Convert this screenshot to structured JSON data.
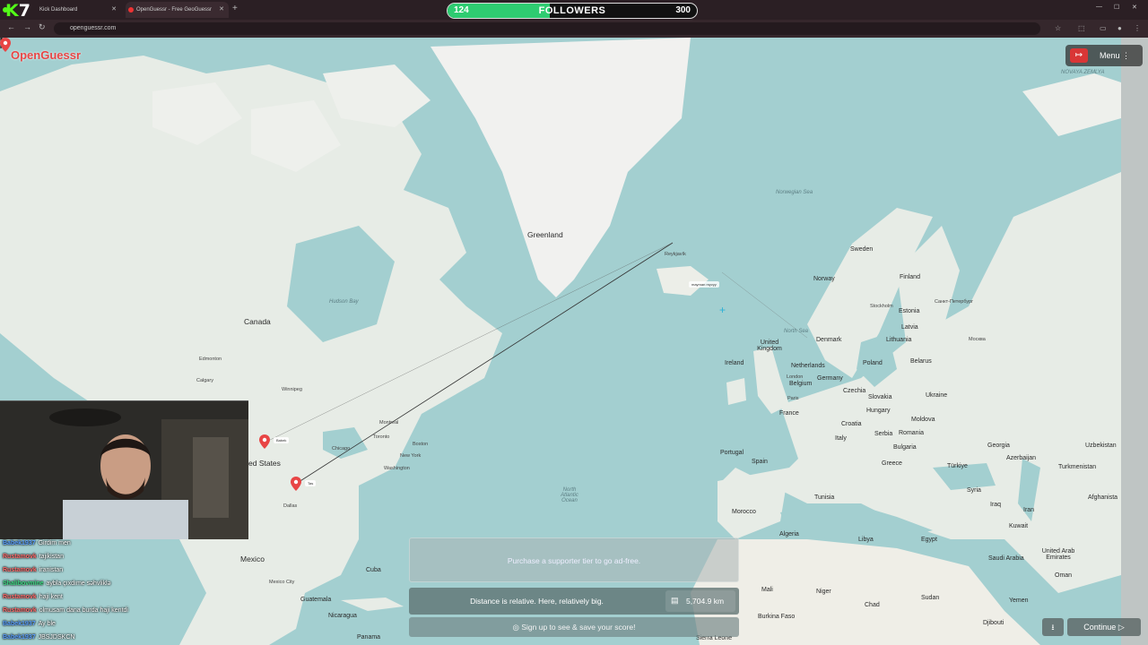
{
  "browser": {
    "tabs": [
      {
        "title": "Kick Dashboard"
      },
      {
        "title": "OpenGuessr - Free GeoGuessr"
      }
    ],
    "url": "openguessr.com"
  },
  "overlay": {
    "kick_badge": "7",
    "followers_current": "124",
    "followers_label": "FOLLOWERS",
    "followers_goal": "300",
    "followers_progress": 0.41
  },
  "game": {
    "brand": "OpenGuessr",
    "menu_label": "Menu",
    "exit_icon": "exit-icon",
    "ad_text": "Purchase a supporter tier to go ad-free.",
    "distance_text": "Distance is relative. Here, relatively big.",
    "distance_value": "5,704.9 km",
    "signup_text": "Sign up to see & save your score!",
    "continue_label": "Continue",
    "guess_tag": "mayman myvyy",
    "players": [
      {
        "name": "Babek"
      },
      {
        "name": "Tas"
      }
    ]
  },
  "map_labels": {
    "greenland": "Greenland",
    "canada": "Canada",
    "united_states": "ed States",
    "mexico": "Mexico",
    "cuba": "Cuba",
    "sweden": "Sweden",
    "norway": "Norway",
    "finland": "Finland",
    "estonia": "Estonia",
    "latvia": "Latvia",
    "lithuania": "Lithuania",
    "denmark": "Denmark",
    "uk": "United Kingdom",
    "ireland": "Ireland",
    "netherlands": "Netherlands",
    "belgium": "Belgium",
    "germany": "Germany",
    "poland": "Poland",
    "belarus": "Belarus",
    "ukraine": "Ukraine",
    "czechia": "Czechia",
    "slovakia": "Slovakia",
    "hungary": "Hungary",
    "moldova": "Moldova",
    "romania": "Romania",
    "france": "France",
    "croatia": "Croatia",
    "serbia": "Serbia",
    "bulgaria": "Bulgaria",
    "italy": "Italy",
    "portugal": "Portugal",
    "spain": "Spain",
    "greece": "Greece",
    "turkiye": "Türkiye",
    "georgia": "Georgia",
    "azerbaijan": "Azerbaijan",
    "uzbekistan": "Uzbekistan",
    "turkmenistan": "Turkmenistan",
    "afghanistan": "Afghanista",
    "syria": "Syria",
    "iraq": "Iraq",
    "iran": "Iran",
    "kuwait": "Kuwait",
    "tunisia": "Tunisia",
    "morocco": "Morocco",
    "algeria": "Algeria",
    "libya": "Libya",
    "egypt": "Egypt",
    "saudi_arabia": "Saudi Arabia",
    "uae": "United Arab Emirates",
    "oman": "Oman",
    "yemen": "Yemen",
    "mali": "Mali",
    "niger": "Niger",
    "chad": "Chad",
    "sudan": "Sudan",
    "burkina": "Burkina Faso",
    "djibouti": "Djibouti",
    "sierra": "Sierra Leone",
    "north_atlantic": "North Atlantic Ocean",
    "norwegian_sea": "Norwegian Sea",
    "hudson_bay": "Hudson Bay",
    "north_sea": "North Sea",
    "novaya": "NOVAYA ZEMLYA",
    "guatemala": "Guatemala",
    "nicaragua": "Nicaragua",
    "panama": "Panama",
    "new_york": "New York",
    "toronto": "Toronto",
    "montreal": "Montreal",
    "chicago": "Chicago",
    "boston": "Boston",
    "washington": "Washington",
    "dallas": "Dallas",
    "calgary": "Calgary",
    "edmonton": "Edmonton",
    "winnipeg": "Winnipeg",
    "london": "London",
    "paris": "Paris",
    "moscow": "Москва",
    "spb": "Санкт-Петербург",
    "stockholm": "Stockholm",
    "reykjavik": "Reykjavík",
    "mexico_city": "Mexico City"
  },
  "chat": [
    {
      "user": "Babek1937",
      "msg": "Girdim men",
      "color": "#5aa0ff"
    },
    {
      "user": "Rustamovk",
      "msg": "tajikistan",
      "color": "#ff6b6b"
    },
    {
      "user": "Rustamovk",
      "msg": "iranistan",
      "color": "#ff6b6b"
    },
    {
      "user": "Shalibovmine",
      "msg": "aybla çıxdıme səhvliklə",
      "color": "#3ddc84"
    },
    {
      "user": "Rustamovk",
      "msg": "haji kent",
      "color": "#ff6b6b"
    },
    {
      "user": "Rustamovk",
      "msg": "olmusam dana burda haji kentdi",
      "color": "#ff6b6b"
    },
    {
      "user": "Babek1937",
      "msg": "Ay ble",
      "color": "#5aa0ff"
    },
    {
      "user": "Babek1937",
      "msg": "JBSJDSKCN",
      "color": "#5aa0ff"
    }
  ]
}
